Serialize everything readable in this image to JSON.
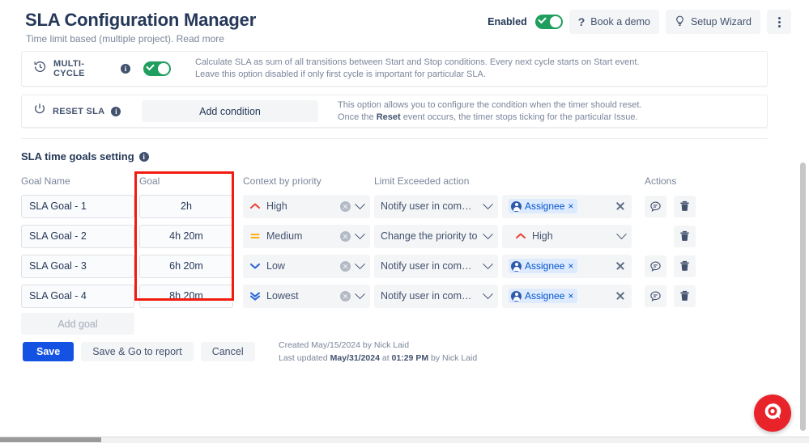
{
  "header": {
    "title": "SLA Configuration Manager",
    "subtitle": "Time limit based (multiple project). Read more",
    "enabled_label": "Enabled",
    "enabled_state": "on",
    "book_demo_label": "Book a demo",
    "setup_wizard_label": "Setup Wizard",
    "more_menu_label": "More actions"
  },
  "options": {
    "multi_cycle": {
      "label": "MULTI-CYCLE",
      "toggle_state": "on",
      "desc_line1": "Calculate SLA as sum of all transitions between Start and Stop conditions. Every next cycle starts on Start event.",
      "desc_line2": "Leave this option disabled if only first cycle is important for particular SLA."
    },
    "reset_sla": {
      "label": "RESET SLA",
      "button_label": "Add condition",
      "desc_line1": "This option allows you to configure the condition when the timer should reset.",
      "desc_line2_pre": "Once the ",
      "desc_line2_bold": "Reset",
      "desc_line2_post": " event occurs, the timer stops ticking for the particular Issue."
    }
  },
  "goals_section": {
    "title": "SLA time goals setting",
    "columns": {
      "goal_name": "Goal Name",
      "goal": "Goal",
      "context": "Context by priority",
      "limit_action": "Limit Exceeded action",
      "actions": "Actions"
    },
    "add_goal_label": "Add goal",
    "rows": [
      {
        "goal_name": "SLA Goal - 1",
        "goal": "2h",
        "priority": "High",
        "priority_icon": "chevron-up-icon",
        "priority_color": "#E9493A",
        "limit_action": "Notify user in comm…",
        "param_type": "chip",
        "param_value": "Assignee",
        "has_comment_action": true
      },
      {
        "goal_name": "SLA Goal - 2",
        "goal": "4h 20m",
        "priority": "Medium",
        "priority_icon": "equals-icon",
        "priority_color": "#FFAB00",
        "limit_action": "Change the priority to",
        "param_type": "priority",
        "param_value": "High",
        "param_icon": "chevron-up-icon",
        "param_color": "#E9493A",
        "has_comment_action": false
      },
      {
        "goal_name": "SLA Goal - 3",
        "goal": "6h 20m",
        "priority": "Low",
        "priority_icon": "chevron-down-icon",
        "priority_color": "#2C67D8",
        "limit_action": "Notify user in comm…",
        "param_type": "chip",
        "param_value": "Assignee",
        "has_comment_action": true
      },
      {
        "goal_name": "SLA Goal - 4",
        "goal": "8h 20m",
        "priority": "Lowest",
        "priority_icon": "double-chevron-down-icon",
        "priority_color": "#2C67D8",
        "limit_action": "Notify user in comm…",
        "param_type": "chip",
        "param_value": "Assignee",
        "has_comment_action": true
      }
    ]
  },
  "footer": {
    "save_label": "Save",
    "save_report_label": "Save & Go to report",
    "cancel_label": "Cancel",
    "created_line_pre": "Created ",
    "created_date": "May/15/2024",
    "created_line_post": " by Nick Laid",
    "updated_pre": "Last updated ",
    "updated_date": "May/31/2024",
    "updated_mid": " at ",
    "updated_time": "01:29 PM",
    "updated_post": " by Nick Laid"
  },
  "highlight": {
    "color": "#F21B0F",
    "target": "goal-column"
  },
  "support_bubble": {
    "label": "support-chat",
    "color": "#E8232A"
  }
}
